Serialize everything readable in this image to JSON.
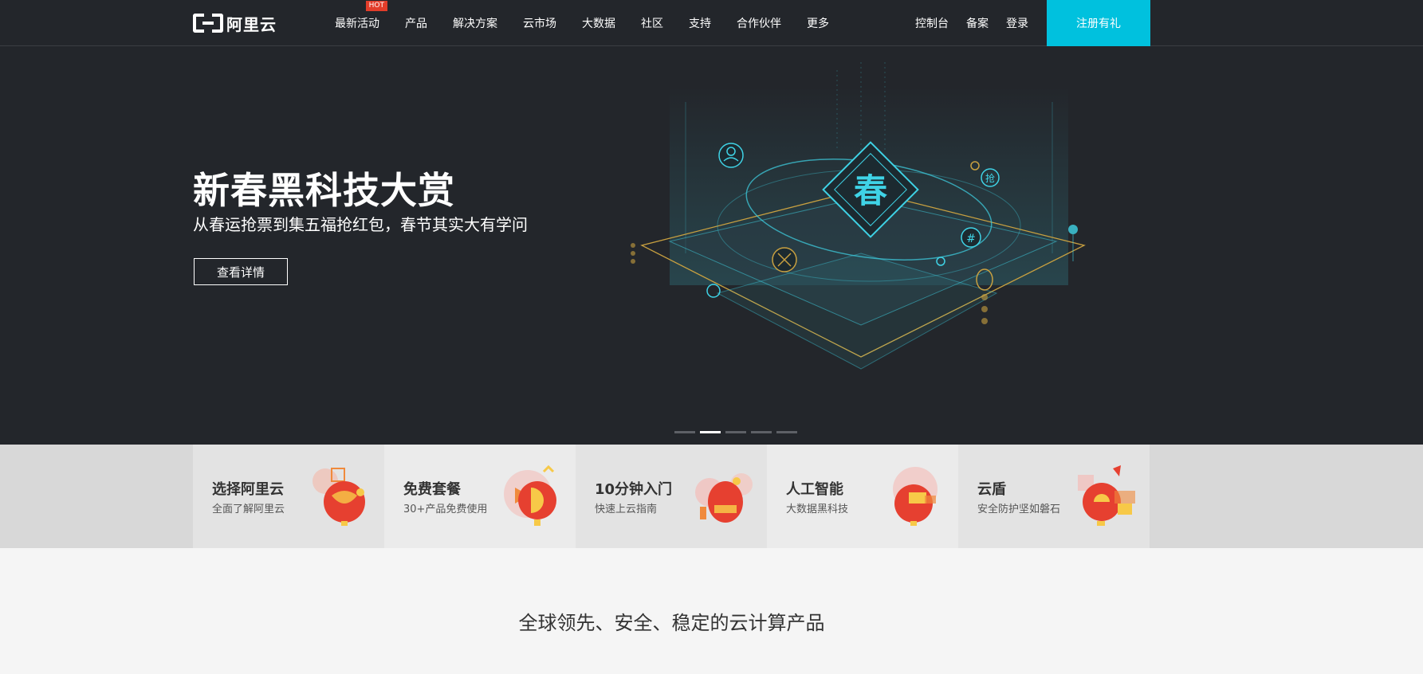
{
  "header": {
    "logo_text": "阿里云",
    "nav": [
      {
        "label": "最新活动",
        "badge": "HOT"
      },
      {
        "label": "产品"
      },
      {
        "label": "解决方案"
      },
      {
        "label": "云市场"
      },
      {
        "label": "大数据"
      },
      {
        "label": "社区"
      },
      {
        "label": "支持"
      },
      {
        "label": "合作伙伴"
      },
      {
        "label": "更多"
      }
    ],
    "right_links": [
      "控制台",
      "备案",
      "登录"
    ],
    "register_label": "注册有礼"
  },
  "hero": {
    "title": "新春黑科技大赏",
    "subtitle": "从春运抢票到集五福抢红包，春节其实大有学问",
    "button_label": "查看详情",
    "art_center_char": "春",
    "art_side_char": "抢",
    "art_hash_char": "#",
    "carousel_active": 2,
    "carousel_count": 5
  },
  "features": [
    {
      "title": "选择阿里云",
      "subtitle": "全面了解阿里云"
    },
    {
      "title": "免费套餐",
      "subtitle": "30+产品免费使用"
    },
    {
      "title": "10分钟入门",
      "subtitle": "快速上云指南"
    },
    {
      "title": "人工智能",
      "subtitle": "大数据黑科技"
    },
    {
      "title": "云盾",
      "subtitle": "安全防护坚如磐石"
    }
  ],
  "section": {
    "title": "全球领先、安全、稳定的云计算产品"
  },
  "colors": {
    "header_bg": "#23262b",
    "accent": "#00c1de",
    "hot_badge": "#e23d2a",
    "art_cyan": "#3fd3e6",
    "art_gold": "#c8a040"
  }
}
